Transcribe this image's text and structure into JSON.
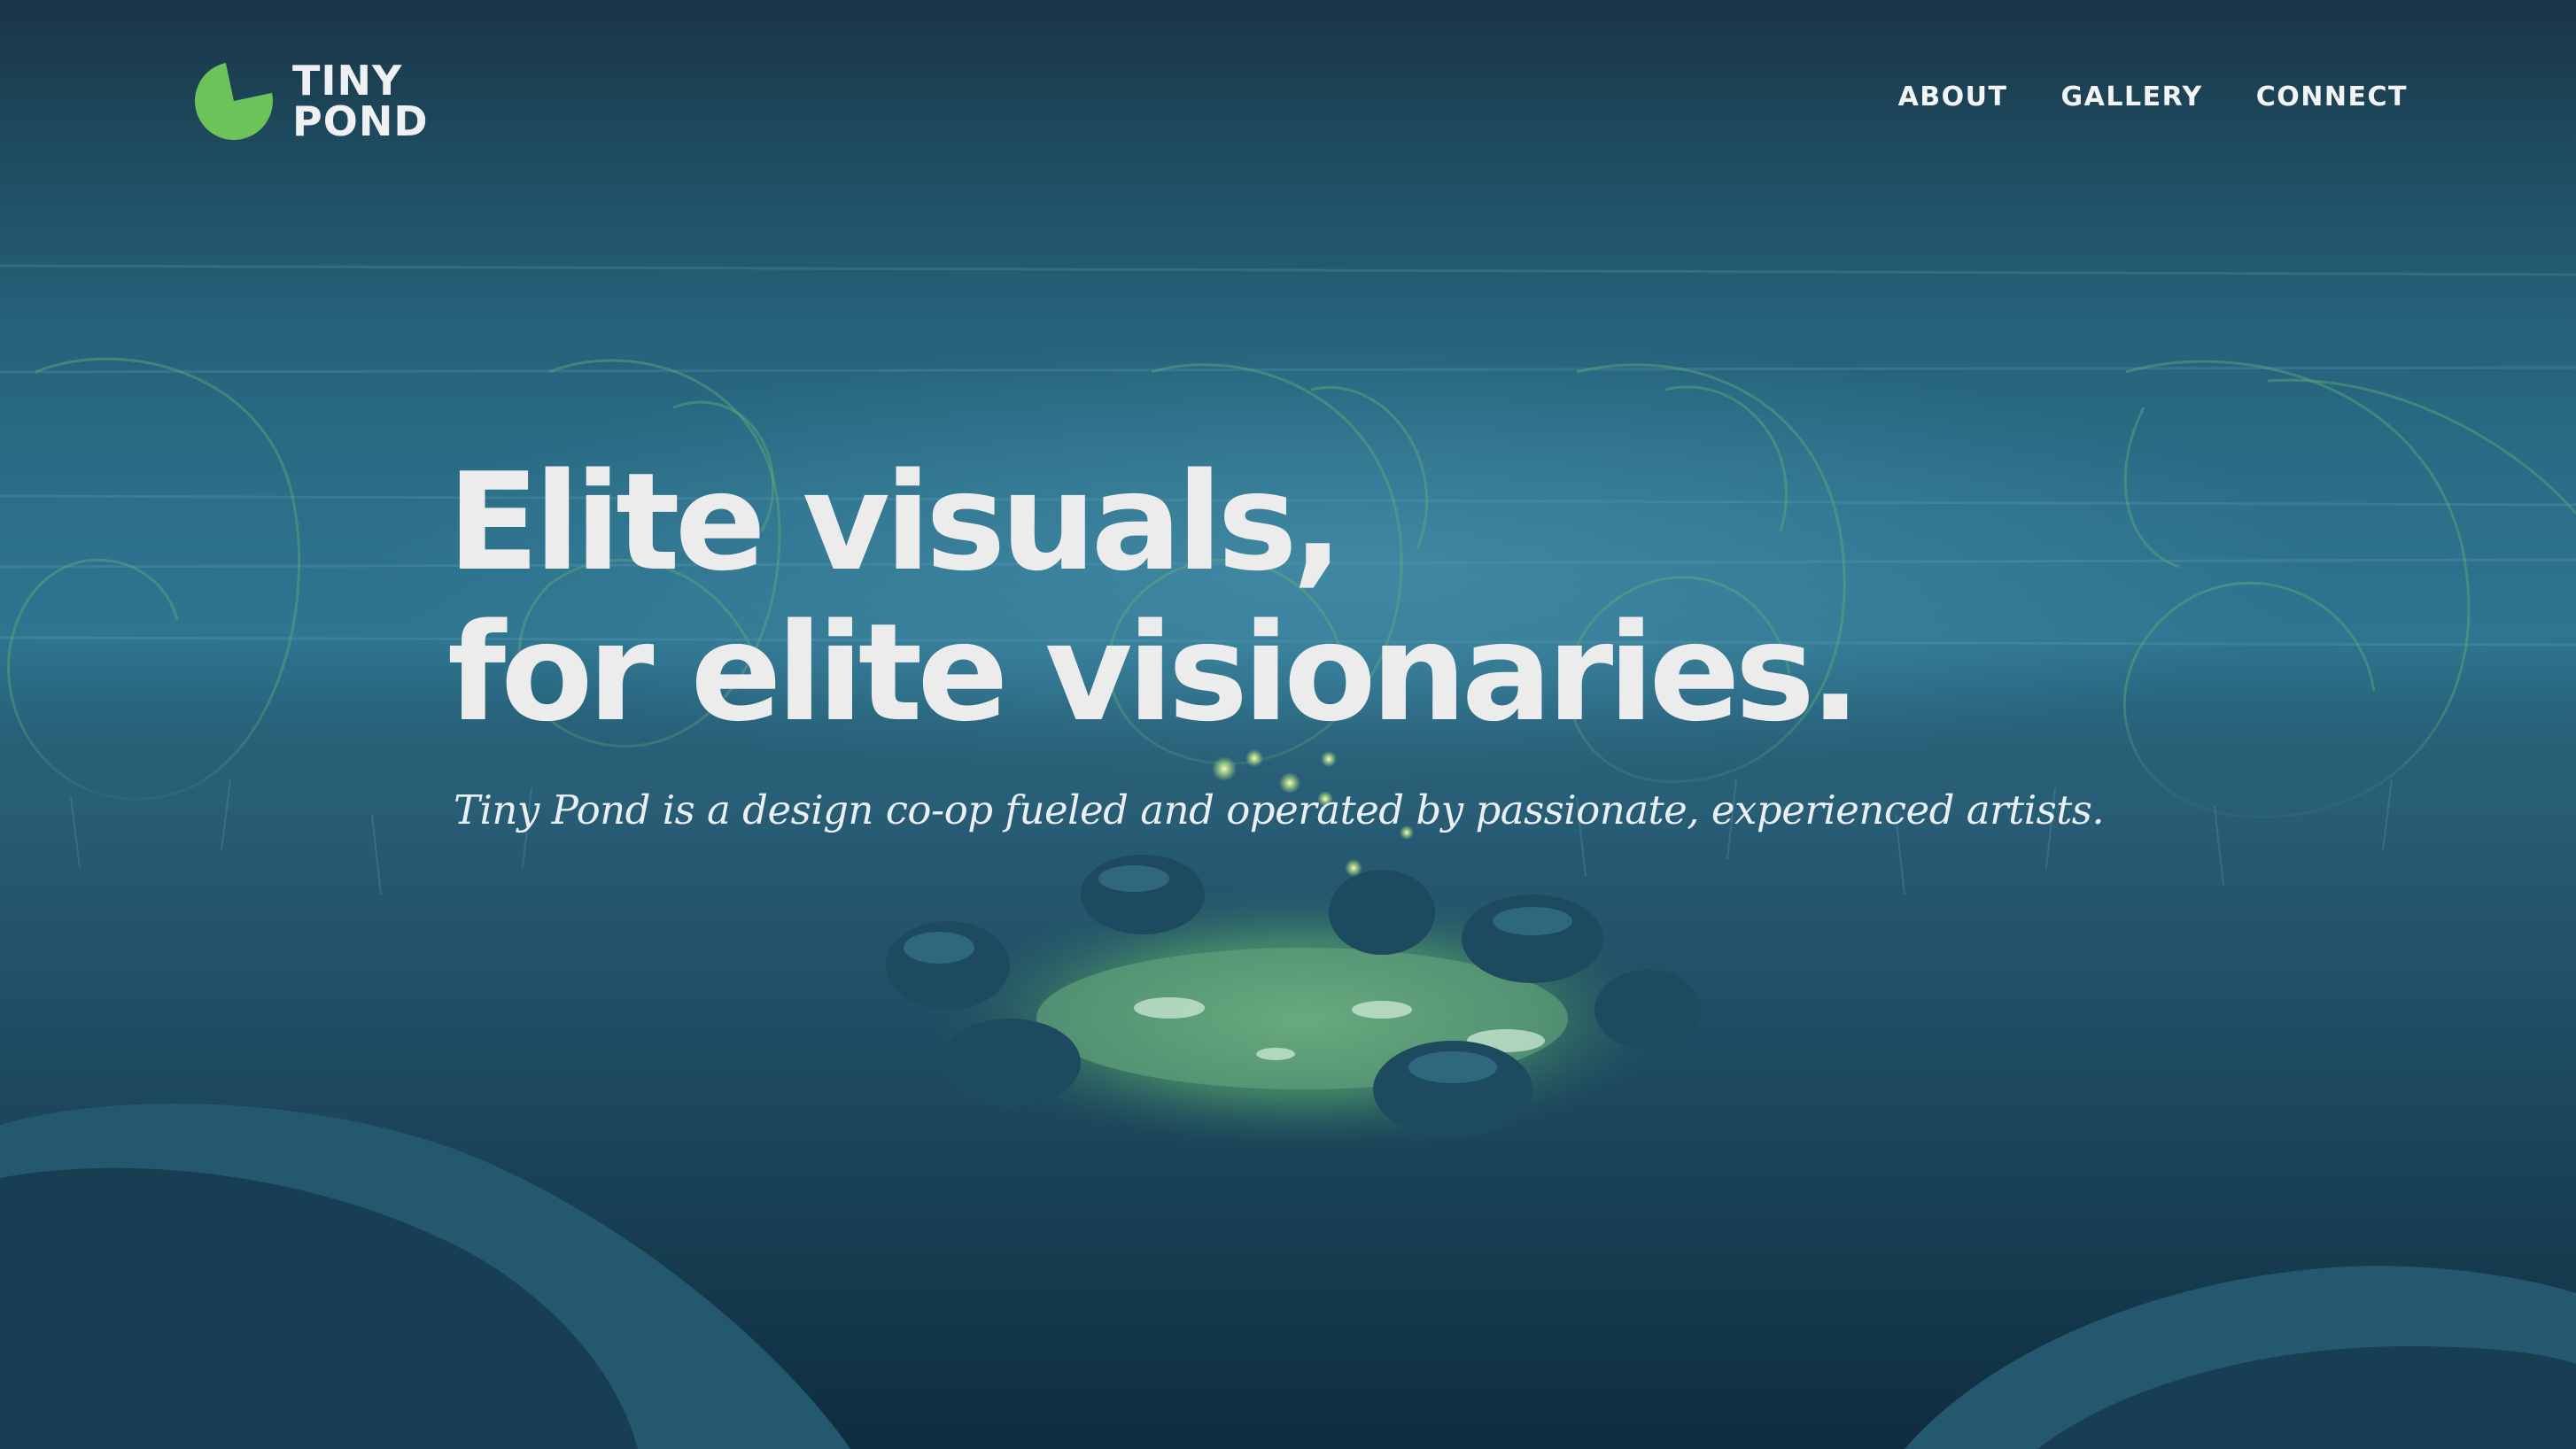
{
  "brand": {
    "name_line1": "TINY",
    "name_line2": "POND",
    "logo_icon": "lily-pad-icon",
    "accent_color": "#6cc35a"
  },
  "nav": {
    "items": [
      {
        "label": "ABOUT"
      },
      {
        "label": "GALLERY"
      },
      {
        "label": "CONNECT"
      }
    ]
  },
  "hero": {
    "headline_line1": "Elite visuals,",
    "headline_line2": "for elite visionaries.",
    "subline": "Tiny Pond is a design co-op fueled and operated by passionate, experienced artists."
  },
  "colors": {
    "headline": "#ececed",
    "background": "#1f5870",
    "pond_glow": "#7fc07a"
  }
}
